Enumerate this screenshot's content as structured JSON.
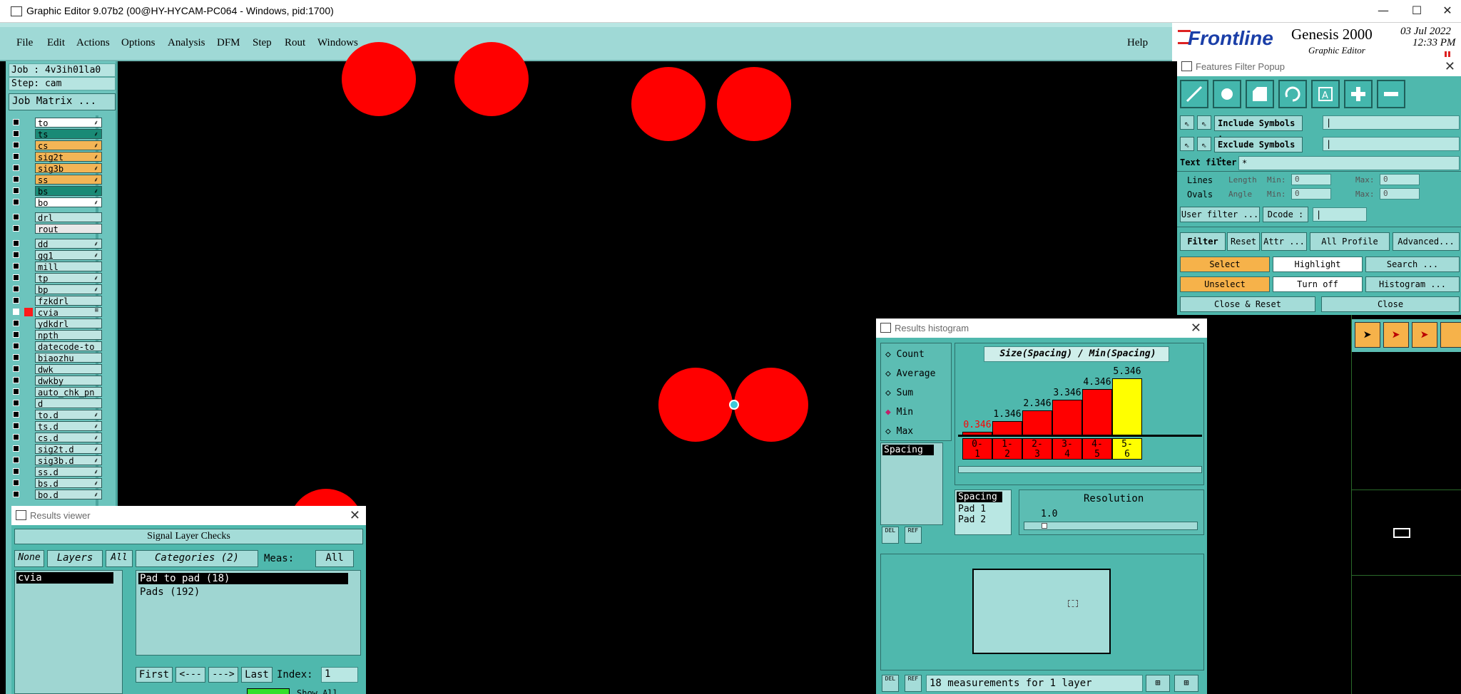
{
  "window": {
    "title": "Graphic Editor 9.07b2 (00@HY-HYCAM-PC064 - Windows, pid:1700)",
    "min_glyph": "—",
    "max_glyph": "☐",
    "close_glyph": "✕"
  },
  "menu": {
    "items": [
      "File",
      "Edit",
      "Actions",
      "Options",
      "Analysis",
      "DFM",
      "Step",
      "Rout",
      "Windows"
    ],
    "help": "Help"
  },
  "brand": {
    "logo": "Frontline",
    "product": "Genesis 2000",
    "subtitle": "Graphic Editor",
    "date": "03 Jul 2022",
    "time": "12:33 PM"
  },
  "left": {
    "job": "Job : 4v3ih01la0",
    "step": "Step: cam",
    "job_matrix": "Job Matrix ...",
    "layers_group1": [
      {
        "name": "to",
        "color": "#ffffff",
        "mark": "⸙"
      },
      {
        "name": "ts",
        "color": "#1a8a76",
        "mark": "⸙"
      },
      {
        "name": "cs",
        "color": "#f3b556",
        "mark": "⸙"
      },
      {
        "name": "sig2t",
        "color": "#f3b556",
        "mark": "⸙"
      },
      {
        "name": "sig3b",
        "color": "#f3b556",
        "mark": "⸙"
      },
      {
        "name": "ss",
        "color": "#f3b556",
        "mark": "⸙"
      },
      {
        "name": "bs",
        "color": "#1a8a76",
        "mark": "⸙"
      },
      {
        "name": "bo",
        "color": "#ffffff",
        "mark": "⸙"
      }
    ],
    "layers_group2": [
      {
        "name": "drl",
        "color": "#bfe5e2",
        "mark": ""
      },
      {
        "name": "rout",
        "color": "#e8e8e8",
        "mark": ""
      }
    ],
    "layers_group3": [
      {
        "name": "dd",
        "color": "#bfe5e2",
        "mark": "⸙"
      },
      {
        "name": "gg1",
        "color": "#bfe5e2",
        "mark": "⸙"
      },
      {
        "name": "mill",
        "color": "#bfe5e2",
        "mark": ""
      },
      {
        "name": "tp",
        "color": "#bfe5e2",
        "mark": "⸙"
      },
      {
        "name": "bp",
        "color": "#bfe5e2",
        "mark": "⸙"
      },
      {
        "name": "fzkdrl",
        "color": "#bfe5e2",
        "mark": ""
      },
      {
        "name": "cvia",
        "color": "#bfe5e2",
        "mark": "≡"
      },
      {
        "name": "ydkdrl",
        "color": "#bfe5e2",
        "mark": ""
      },
      {
        "name": "npth",
        "color": "#bfe5e2",
        "mark": ""
      },
      {
        "name": "datecode-to",
        "color": "#bfe5e2",
        "mark": ""
      },
      {
        "name": "biaozhu",
        "color": "#bfe5e2",
        "mark": ""
      },
      {
        "name": "dwk",
        "color": "#bfe5e2",
        "mark": ""
      },
      {
        "name": "dwkby",
        "color": "#bfe5e2",
        "mark": ""
      },
      {
        "name": "auto_chk_pn",
        "color": "#bfe5e2",
        "mark": ""
      },
      {
        "name": "d",
        "color": "#bfe5e2",
        "mark": ""
      },
      {
        "name": "to.d",
        "color": "#bfe5e2",
        "mark": "⸙"
      },
      {
        "name": "ts.d",
        "color": "#bfe5e2",
        "mark": "⸙"
      },
      {
        "name": "cs.d",
        "color": "#bfe5e2",
        "mark": "⸙"
      },
      {
        "name": "sig2t.d",
        "color": "#bfe5e2",
        "mark": "⸙"
      },
      {
        "name": "sig3b.d",
        "color": "#bfe5e2",
        "mark": "⸙"
      },
      {
        "name": "ss.d",
        "color": "#bfe5e2",
        "mark": "⸙"
      },
      {
        "name": "bs.d",
        "color": "#bfe5e2",
        "mark": "⸙"
      },
      {
        "name": "bo.d",
        "color": "#bfe5e2",
        "mark": "⸙"
      }
    ]
  },
  "filter_popup": {
    "title": "Features Filter Popup",
    "include_symbols": "Include Symbols :",
    "exclude_symbols": "Exclude Symbols :",
    "text_filter": "Text filter",
    "text_filter_value": "*",
    "lines": "Lines",
    "ovals": "Ovals",
    "length": "Length",
    "angle": "Angle",
    "min": "Min:",
    "max": "Max:",
    "length_min": "0",
    "length_max": "0",
    "angle_min": "0",
    "angle_max": "0",
    "user_filter": "User filter ...",
    "dcode": "Dcode :",
    "filter": "Filter",
    "reset": "Reset",
    "attr": "Attr ...",
    "all_profile": "All Profile",
    "advanced": "Advanced...",
    "select": "Select",
    "highlight": "Highlight",
    "search": "Search ...",
    "unselect": "Unselect",
    "turn_off": "Turn off",
    "histogram": "Histogram ...",
    "close_reset": "Close & Reset",
    "close": "Close"
  },
  "results_viewer": {
    "title": "Results viewer",
    "header": "Signal Layer Checks",
    "none": "None",
    "layers": "Layers",
    "all": "All",
    "categories": "Categories (2)",
    "meas": "Meas:",
    "meas_value": "All",
    "layer_items": [
      "cvia"
    ],
    "category_items": [
      "Pad to pad (18)",
      "Pads (192)"
    ],
    "first": "First",
    "prev": "<---",
    "next": "--->",
    "last": "Last",
    "index": "Index:",
    "index_value": "1",
    "show_all": "Show All"
  },
  "results_histogram": {
    "title": "Results histogram",
    "options": [
      {
        "label": "Count",
        "selected": false
      },
      {
        "label": "Average",
        "selected": false
      },
      {
        "label": "Sum",
        "selected": false
      },
      {
        "label": "Min",
        "selected": true
      },
      {
        "label": "Max",
        "selected": false
      }
    ],
    "list_items": [
      "Spacing"
    ],
    "chart_title": "Size(Spacing) / Min(Spacing)",
    "resolution": "Resolution",
    "resolution_value": "1.0",
    "measure_items": [
      "Spacing",
      "Pad 1",
      "Pad 2"
    ],
    "del": "DEL",
    "ref": "REF",
    "status": "18 measurements for 1 layer"
  },
  "chart_data": {
    "type": "bar",
    "title": "Size(Spacing) / Min(Spacing)",
    "categories": [
      "0-1",
      "1-2",
      "2-3",
      "3-4",
      "4-5",
      "5-6"
    ],
    "category_top": [
      "0-",
      "1-",
      "2-",
      "3-",
      "4-",
      "5-"
    ],
    "category_bottom": [
      "1",
      "2",
      "3",
      "4",
      "5",
      "6"
    ],
    "values": [
      0.346,
      1.346,
      2.346,
      3.346,
      4.346,
      5.346
    ],
    "value_labels": [
      "0.346",
      "1.346",
      "2.346",
      "3.346",
      "4.346",
      "5.346"
    ],
    "highlight_index": 5,
    "ylim": [
      0,
      5.346
    ],
    "colors": {
      "bar": "#ff0000",
      "highlight": "#ffff00",
      "first_label": "#ff0000"
    }
  },
  "colors": {
    "panel": "#9fd9d6",
    "accent": "#4fb8ad",
    "pad": "#ff0000",
    "select_btn": "#f6b24a"
  }
}
